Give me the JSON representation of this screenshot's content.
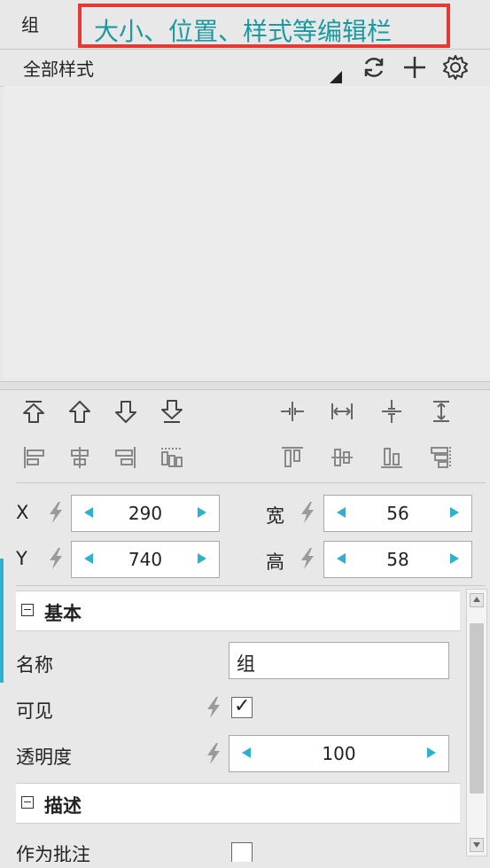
{
  "panel": {
    "title": "组"
  },
  "annotation": {
    "text": "大小、位置、样式等编辑栏",
    "border_color": "#e53935",
    "text_color": "#1a9aa0"
  },
  "styles": {
    "label": "全部样式",
    "icons": [
      "dropdown-triangle-icon",
      "refresh-icon",
      "add-icon",
      "settings-gear-icon"
    ]
  },
  "toolbar": {
    "arrange_icons": [
      "bring-to-front-icon",
      "bring-forward-icon",
      "send-backward-icon",
      "send-to-back-icon"
    ],
    "distribute_icons": [
      "distribute-horizontal-icon",
      "distribute-horizontal-space-icon",
      "distribute-vertical-icon",
      "distribute-vertical-space-icon"
    ],
    "align_left_icons": [
      "align-left-icon",
      "align-center-icon",
      "align-right-icon",
      "align-dotted-icon"
    ],
    "align_right_icons": [
      "align-top-icon",
      "align-middle-icon",
      "align-bottom-icon",
      "align-dotted-right-icon"
    ]
  },
  "geometry": {
    "x": {
      "label": "X",
      "value": "290"
    },
    "y": {
      "label": "Y",
      "value": "740"
    },
    "w": {
      "label": "宽",
      "value": "56"
    },
    "h": {
      "label": "高",
      "value": "58"
    }
  },
  "basic": {
    "title": "基本",
    "name_label": "名称",
    "name_value": "组",
    "visible_label": "可见",
    "visible_checked": true,
    "visible_mark": "✓",
    "opacity_label": "透明度",
    "opacity_value": "100"
  },
  "description": {
    "title": "描述",
    "annotation_label": "作为批注",
    "annotation_checked": false
  },
  "colors": {
    "accent": "#2eb0cf"
  }
}
